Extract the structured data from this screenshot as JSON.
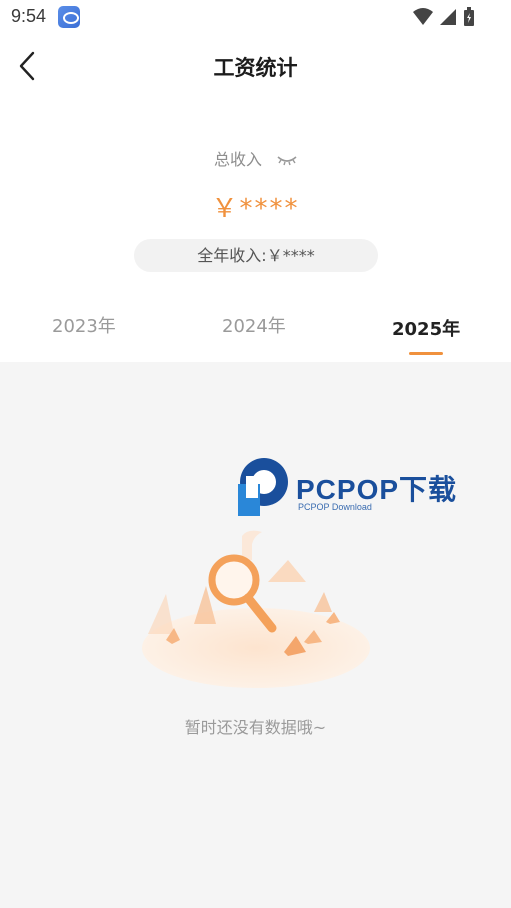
{
  "status_bar": {
    "time": "9:54",
    "icons": [
      "app-notification-icon",
      "wifi-icon",
      "signal-icon",
      "battery-icon"
    ]
  },
  "header": {
    "title": "工资统计",
    "back_icon": "chevron-left-icon"
  },
  "summary": {
    "total_label": "总收入",
    "visibility_icon": "eye-closed-icon",
    "total_amount": "￥****",
    "annual_label": "全年收入:￥****"
  },
  "tabs": [
    {
      "label": "2023年",
      "selected": false
    },
    {
      "label": "2024年",
      "selected": false
    },
    {
      "label": "2025年",
      "selected": true
    }
  ],
  "empty_state": {
    "message": "暂时还没有数据哦~",
    "illustration_icon": "magnifier-empty-illustration"
  },
  "watermark": {
    "title": "PCPOP下载",
    "subtitle": "PCPOP Download"
  },
  "colors": {
    "accent": "#f0913d",
    "background": "#f5f5f5",
    "card": "#ffffff"
  }
}
